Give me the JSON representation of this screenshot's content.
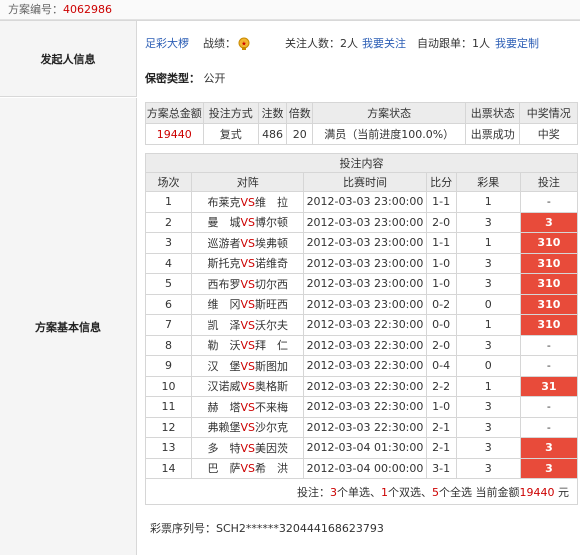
{
  "header": {
    "label": "方案编号：",
    "number": "4062986"
  },
  "sections": {
    "initiator": "发起人信息",
    "basic": "方案基本信息"
  },
  "initiator": {
    "name": "足彩大椤",
    "record_label": "战绩：",
    "followers_label": "关注人数：",
    "followers_count": "2人",
    "follow_link": "我要关注",
    "auto_label": "自动跟单：",
    "auto_count": "1人",
    "custom_link": "我要定制",
    "secret_label": "保密类型：",
    "secret_value": "公开"
  },
  "summary": {
    "headers": [
      "方案总金额",
      "投注方式",
      "注数",
      "倍数",
      "方案状态",
      "出票状态",
      "中奖情况"
    ],
    "values": [
      "19440",
      "复式",
      "486",
      "20",
      "满员（当前进度100.0%）",
      "出票成功",
      "中奖"
    ]
  },
  "bets": {
    "title": "投注内容",
    "headers": [
      "场次",
      "对阵",
      "比赛时间",
      "比分",
      "彩果",
      "投注"
    ],
    "rows": [
      {
        "no": "1",
        "home": "布莱克",
        "away": "维　拉",
        "time": "2012-03-03 23:00:00",
        "score": "1-1",
        "result": "1",
        "bet": "-",
        "hl": false
      },
      {
        "no": "2",
        "home": "曼　城",
        "away": "博尔顿",
        "time": "2012-03-03 23:00:00",
        "score": "2-0",
        "result": "3",
        "bet": "3",
        "hl": true
      },
      {
        "no": "3",
        "home": "巡游者",
        "away": "埃弗顿",
        "time": "2012-03-03 23:00:00",
        "score": "1-1",
        "result": "1",
        "bet": "310",
        "hl": true
      },
      {
        "no": "4",
        "home": "斯托克",
        "away": "诺维奇",
        "time": "2012-03-03 23:00:00",
        "score": "1-0",
        "result": "3",
        "bet": "310",
        "hl": true
      },
      {
        "no": "5",
        "home": "西布罗",
        "away": "切尔西",
        "time": "2012-03-03 23:00:00",
        "score": "1-0",
        "result": "3",
        "bet": "310",
        "hl": true
      },
      {
        "no": "6",
        "home": "维　冈",
        "away": "斯旺西",
        "time": "2012-03-03 23:00:00",
        "score": "0-2",
        "result": "0",
        "bet": "310",
        "hl": true
      },
      {
        "no": "7",
        "home": "凯　泽",
        "away": "沃尔夫",
        "time": "2012-03-03 22:30:00",
        "score": "0-0",
        "result": "1",
        "bet": "310",
        "hl": true
      },
      {
        "no": "8",
        "home": "勒　沃",
        "away": "拜　仁",
        "time": "2012-03-03 22:30:00",
        "score": "2-0",
        "result": "3",
        "bet": "-",
        "hl": false
      },
      {
        "no": "9",
        "home": "汉　堡",
        "away": "斯图加",
        "time": "2012-03-03 22:30:00",
        "score": "0-4",
        "result": "0",
        "bet": "-",
        "hl": false
      },
      {
        "no": "10",
        "home": "汉诺威",
        "away": "奥格斯",
        "time": "2012-03-03 22:30:00",
        "score": "2-2",
        "result": "1",
        "bet": "31",
        "hl": true
      },
      {
        "no": "11",
        "home": "赫　塔",
        "away": "不来梅",
        "time": "2012-03-03 22:30:00",
        "score": "1-0",
        "result": "3",
        "bet": "-",
        "hl": false
      },
      {
        "no": "12",
        "home": "弗赖堡",
        "away": "沙尔克",
        "time": "2012-03-03 22:30:00",
        "score": "2-1",
        "result": "3",
        "bet": "-",
        "hl": false
      },
      {
        "no": "13",
        "home": "多　特",
        "away": "美因茨",
        "time": "2012-03-04 01:30:00",
        "score": "2-1",
        "result": "3",
        "bet": "3",
        "hl": true
      },
      {
        "no": "14",
        "home": "巴　萨",
        "away": "希　洪",
        "time": "2012-03-04 00:00:00",
        "score": "3-1",
        "result": "3",
        "bet": "3",
        "hl": true
      }
    ],
    "vs": "VS",
    "summary_line": {
      "p1": "投注：",
      "single_n": "3",
      "single_t": "个单选、",
      "double_n": "1",
      "double_t": "个双选、",
      "full_n": "5",
      "full_t": "个全选 当前金额",
      "amount": "19440",
      "unit": " 元"
    }
  },
  "serial": {
    "label": "彩票序列号：",
    "value": "SCH2******320444168623793"
  }
}
